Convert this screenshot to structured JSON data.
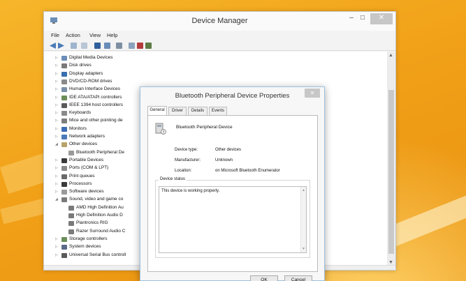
{
  "window": {
    "title": "Device Manager",
    "controls": {
      "minimize": "–",
      "maximize": "□",
      "close": "✕"
    }
  },
  "menu": [
    "File",
    "Action",
    "View",
    "Help"
  ],
  "toolbar_icons": [
    "back-icon",
    "forward-icon",
    "properties-grid-icon",
    "help-icon",
    "update-driver-icon",
    "monitor-icon",
    "scan-icon",
    "disable-icon",
    "uninstall-icon",
    "add-legacy-icon"
  ],
  "tree": [
    {
      "label": "Digital Media Devices",
      "expanded": false,
      "indent": 0,
      "icon_color": "#6a8cb8"
    },
    {
      "label": "Disk drives",
      "expanded": false,
      "indent": 0,
      "icon_color": "#7a7a7a"
    },
    {
      "label": "Display adapters",
      "expanded": false,
      "indent": 0,
      "icon_color": "#3a6fb0"
    },
    {
      "label": "DVD/CD-ROM drives",
      "expanded": false,
      "indent": 0,
      "icon_color": "#8a8a8a"
    },
    {
      "label": "Human Interface Devices",
      "expanded": false,
      "indent": 0,
      "icon_color": "#7a8fa8"
    },
    {
      "label": "IDE ATA/ATAPI controllers",
      "expanded": false,
      "indent": 0,
      "icon_color": "#6b8e5a"
    },
    {
      "label": "IEEE 1394 host controllers",
      "expanded": false,
      "indent": 0,
      "icon_color": "#5a5a5a"
    },
    {
      "label": "Keyboards",
      "expanded": false,
      "indent": 0,
      "icon_color": "#8a8a8a"
    },
    {
      "label": "Mice and other pointing de",
      "expanded": false,
      "indent": 0,
      "icon_color": "#7d7d7d"
    },
    {
      "label": "Monitors",
      "expanded": false,
      "indent": 0,
      "icon_color": "#3b6cb5"
    },
    {
      "label": "Network adapters",
      "expanded": false,
      "indent": 0,
      "icon_color": "#4a7ab8"
    },
    {
      "label": "Other devices",
      "expanded": true,
      "indent": 0,
      "icon_color": "#b8a46a"
    },
    {
      "label": "Bluetooth Peripheral De",
      "expanded": null,
      "indent": 1,
      "icon_color": "#9a9a9a"
    },
    {
      "label": "Portable Devices",
      "expanded": false,
      "indent": 0,
      "icon_color": "#3a3a3a"
    },
    {
      "label": "Ports (COM & LPT)",
      "expanded": false,
      "indent": 0,
      "icon_color": "#8a8a8a"
    },
    {
      "label": "Print queues",
      "expanded": false,
      "indent": 0,
      "icon_color": "#6a6a6a"
    },
    {
      "label": "Processors",
      "expanded": false,
      "indent": 0,
      "icon_color": "#3a3a3a"
    },
    {
      "label": "Software devices",
      "expanded": false,
      "indent": 0,
      "icon_color": "#9a9a9a"
    },
    {
      "label": "Sound, video and game co",
      "expanded": true,
      "indent": 0,
      "icon_color": "#7a7a7a"
    },
    {
      "label": "AMD High Definition Au",
      "expanded": null,
      "indent": 1,
      "icon_color": "#7a7a7a"
    },
    {
      "label": "High Definition Audio D",
      "expanded": null,
      "indent": 1,
      "icon_color": "#7a7a7a"
    },
    {
      "label": "Plantronics RIG",
      "expanded": null,
      "indent": 1,
      "icon_color": "#7a7a7a"
    },
    {
      "label": "Razer Surround Audio C",
      "expanded": null,
      "indent": 1,
      "icon_color": "#7a7a7a"
    },
    {
      "label": "Storage controllers",
      "expanded": false,
      "indent": 0,
      "icon_color": "#6b8e5a"
    },
    {
      "label": "System devices",
      "expanded": false,
      "indent": 0,
      "icon_color": "#5a6a8a"
    },
    {
      "label": "Universal Serial Bus controll",
      "expanded": false,
      "indent": 0,
      "icon_color": "#5a5a5a"
    }
  ],
  "dialog": {
    "title": "Bluetooth Peripheral Device Properties",
    "close": "✕",
    "tabs": [
      "General",
      "Driver",
      "Details",
      "Events"
    ],
    "active_tab": "General",
    "device_name": "Bluetooth Peripheral Device",
    "properties": [
      {
        "key": "Device type:",
        "value": "Other devices"
      },
      {
        "key": "Manufacturer:",
        "value": "Unknown"
      },
      {
        "key": "Location:",
        "value": "on Microsoft Bluetooth Enumerator"
      }
    ],
    "status_group_label": "Device status",
    "status_text": "This device is working properly.",
    "buttons": {
      "ok": "OK",
      "cancel": "Cancel"
    }
  }
}
